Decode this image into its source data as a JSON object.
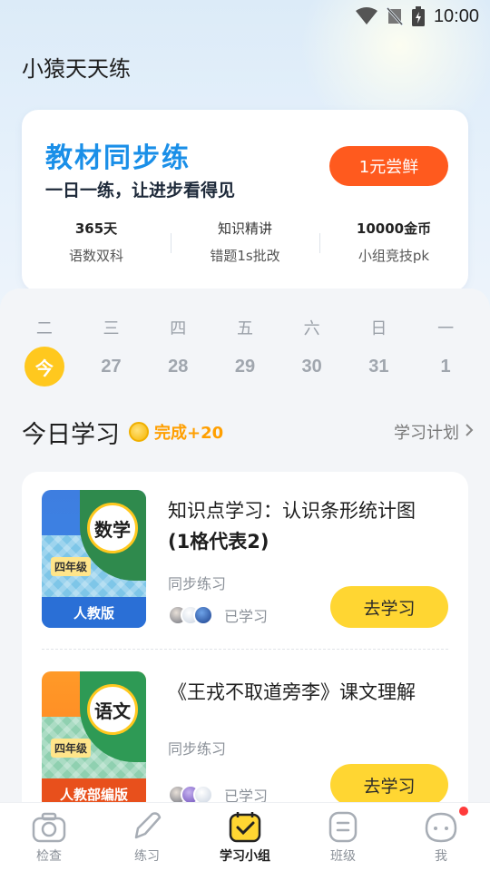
{
  "status_bar": {
    "time": "10:00",
    "icons": [
      "wifi-icon",
      "signal-off-icon",
      "battery-charging-icon"
    ]
  },
  "app": {
    "title": "小猿天天练"
  },
  "banner": {
    "title": "教材同步练",
    "subtitle": "一日一练，让进步看得见",
    "button": "1元尝鲜",
    "stats": [
      {
        "top": "365天",
        "bottom": "语数双科"
      },
      {
        "top": "知识精讲",
        "bottom": "错题1s批改"
      },
      {
        "top": "10000金币",
        "bottom": "小组竞技pk"
      }
    ]
  },
  "week": [
    {
      "name": "二",
      "num": "今",
      "today": true
    },
    {
      "name": "三",
      "num": "27"
    },
    {
      "name": "四",
      "num": "28"
    },
    {
      "name": "五",
      "num": "29"
    },
    {
      "name": "六",
      "num": "30"
    },
    {
      "name": "日",
      "num": "31"
    },
    {
      "name": "一",
      "num": "1"
    }
  ],
  "today_study": {
    "title": "今日学习",
    "reward": "完成+20",
    "plan_link": "学习计划"
  },
  "items": [
    {
      "book": {
        "subject": "数学",
        "grade": "四年级",
        "edition": "人教版"
      },
      "title": "知识点学习：认识条形统计图",
      "title_bold": "(1格代表2)",
      "tag": "同步练习",
      "learned": "已学习",
      "button": "去学习"
    },
    {
      "book": {
        "subject": "语文",
        "grade": "四年级",
        "edition": "人教部编版"
      },
      "title": "《王戎不取道旁李》课文理解",
      "tag": "同步练习",
      "learned": "已学习",
      "button": "去学习"
    }
  ],
  "nav": [
    {
      "label": "检查",
      "icon": "camera-icon"
    },
    {
      "label": "练习",
      "icon": "pencil-icon"
    },
    {
      "label": "学习小组",
      "icon": "checklist-icon",
      "active": true
    },
    {
      "label": "班级",
      "icon": "class-icon"
    },
    {
      "label": "我",
      "icon": "profile-icon",
      "badge": true
    }
  ],
  "colors": {
    "accent_yellow": "#ffd632",
    "brand_blue": "#1a8fe8",
    "cta_orange": "#ff5a1e"
  }
}
